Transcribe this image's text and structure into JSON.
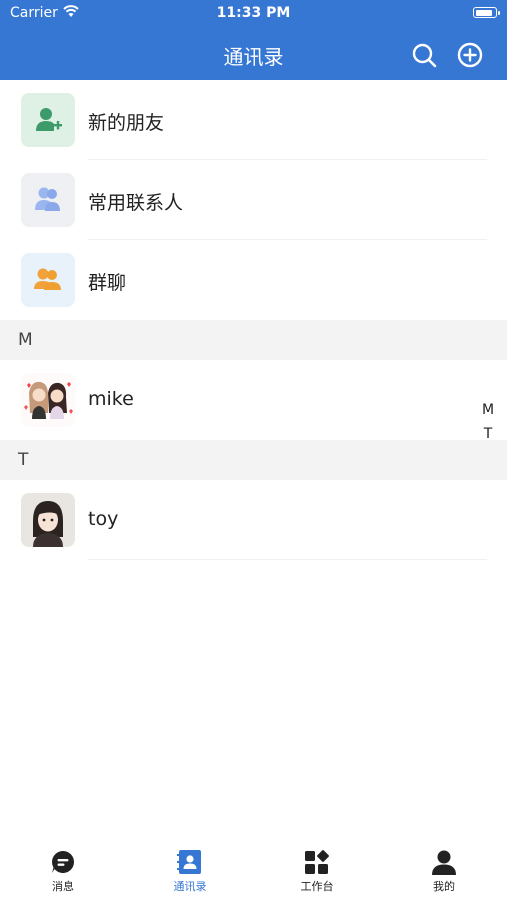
{
  "status_bar": {
    "carrier": "Carrier",
    "time": "11:33 PM",
    "battery_level": 0.9
  },
  "nav": {
    "title": "通讯录",
    "search_icon": "search-icon",
    "add_icon": "plus-circle-icon"
  },
  "shortcuts": [
    {
      "label": "新的朋友",
      "icon": "add-friend-icon"
    },
    {
      "label": "常用联系人",
      "icon": "contacts-icon"
    },
    {
      "label": "群聊",
      "icon": "group-icon"
    }
  ],
  "sections": [
    {
      "letter": "M",
      "contacts": [
        {
          "name": "mike"
        }
      ]
    },
    {
      "letter": "T",
      "contacts": [
        {
          "name": "toy"
        }
      ]
    }
  ],
  "index_letters": [
    "M",
    "T"
  ],
  "tabs": [
    {
      "label": "消息",
      "icon": "message-icon",
      "active": false
    },
    {
      "label": "通讯录",
      "icon": "contacts-book-icon",
      "active": true
    },
    {
      "label": "工作台",
      "icon": "workbench-icon",
      "active": false
    },
    {
      "label": "我的",
      "icon": "profile-icon",
      "active": false
    }
  ],
  "colors": {
    "accent": "#3777d4",
    "section_bg": "#f3f3f3"
  }
}
